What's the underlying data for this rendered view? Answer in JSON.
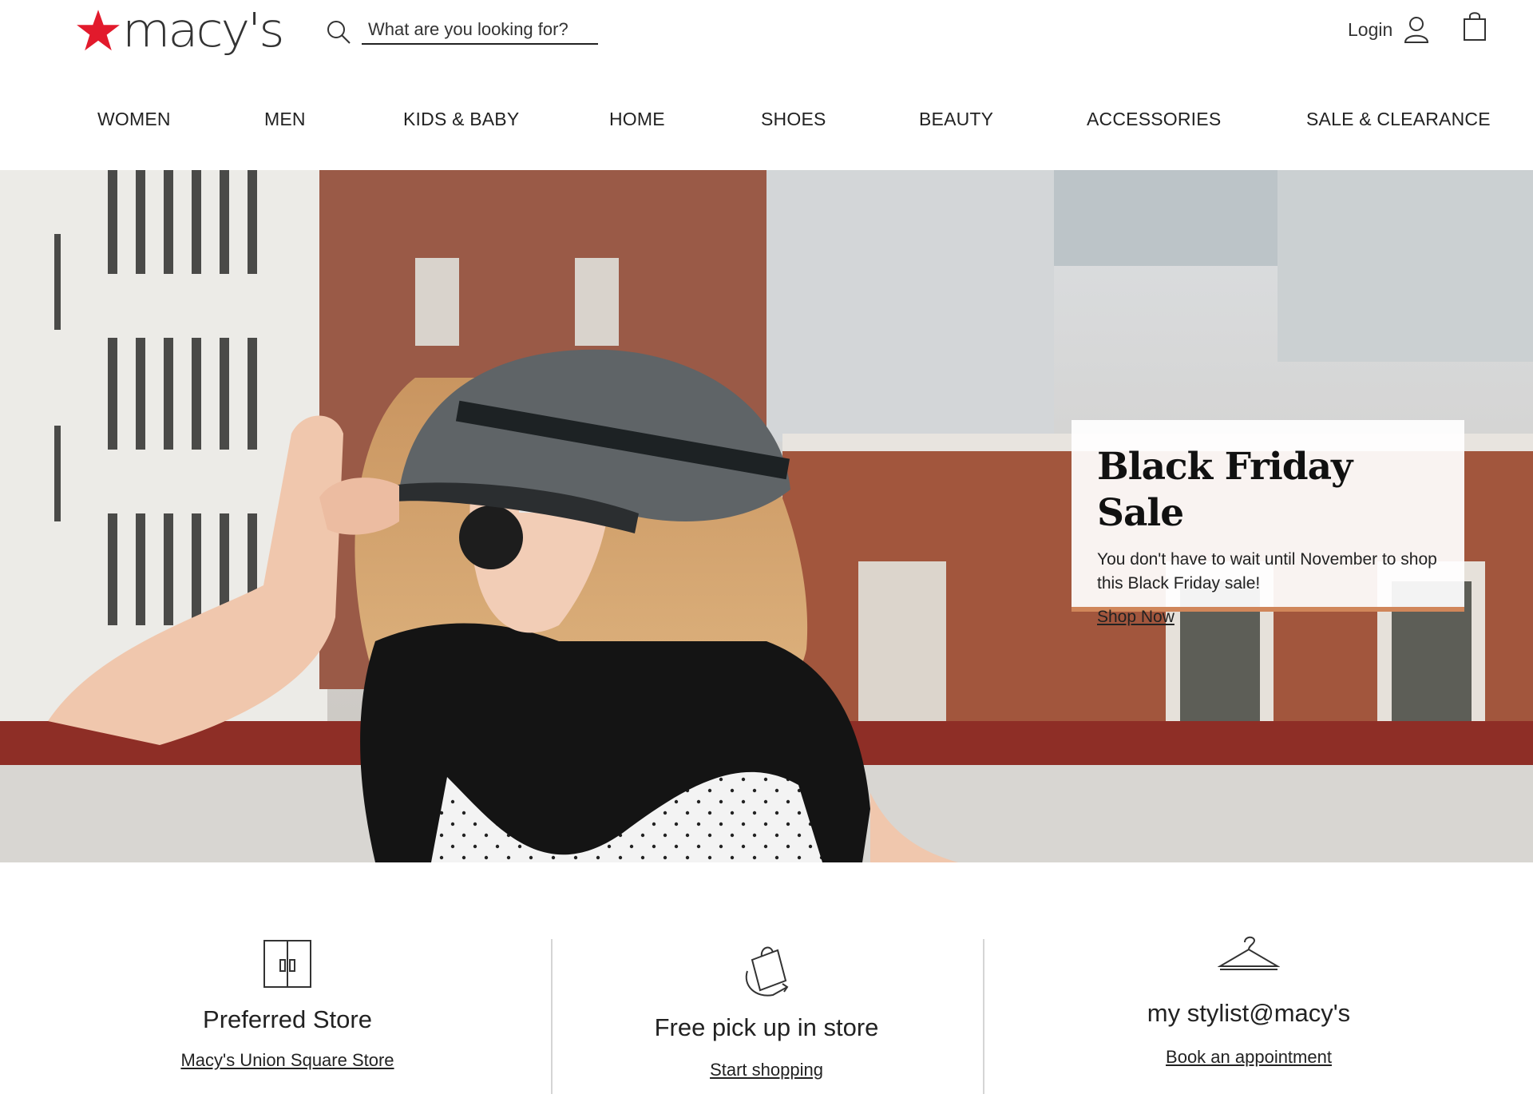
{
  "header": {
    "logo_text": "macy's",
    "search": {
      "placeholder": "What are you looking for?"
    },
    "login_label": "Login",
    "brand_color": "#e21a2c",
    "icons": [
      "search-icon",
      "user-icon",
      "shopping-bag-icon",
      "star-logo-icon"
    ]
  },
  "nav": {
    "items": [
      {
        "label": "WOMEN"
      },
      {
        "label": "MEN"
      },
      {
        "label": "KIDS & BABY"
      },
      {
        "label": "HOME"
      },
      {
        "label": "SHOES"
      },
      {
        "label": "BEAUTY"
      },
      {
        "label": "ACCESSORIES"
      },
      {
        "label": "SALE & CLEARANCE"
      }
    ]
  },
  "hero": {
    "promo": {
      "title": "Black Friday Sale",
      "description": "You don't have to wait until November to shop this Black Friday sale!",
      "link_label": "Shop Now",
      "accent_color": "#d0865a"
    }
  },
  "features": [
    {
      "icon": "store-doors-icon",
      "title": "Preferred Store",
      "link_label": "Macy's Union Square Store"
    },
    {
      "icon": "shopping-bag-pickup-icon",
      "title": "Free pick up in store",
      "link_label": "Start shopping"
    },
    {
      "icon": "hanger-icon",
      "title": "my stylist@macy's",
      "link_label": "Book an appointment"
    }
  ]
}
